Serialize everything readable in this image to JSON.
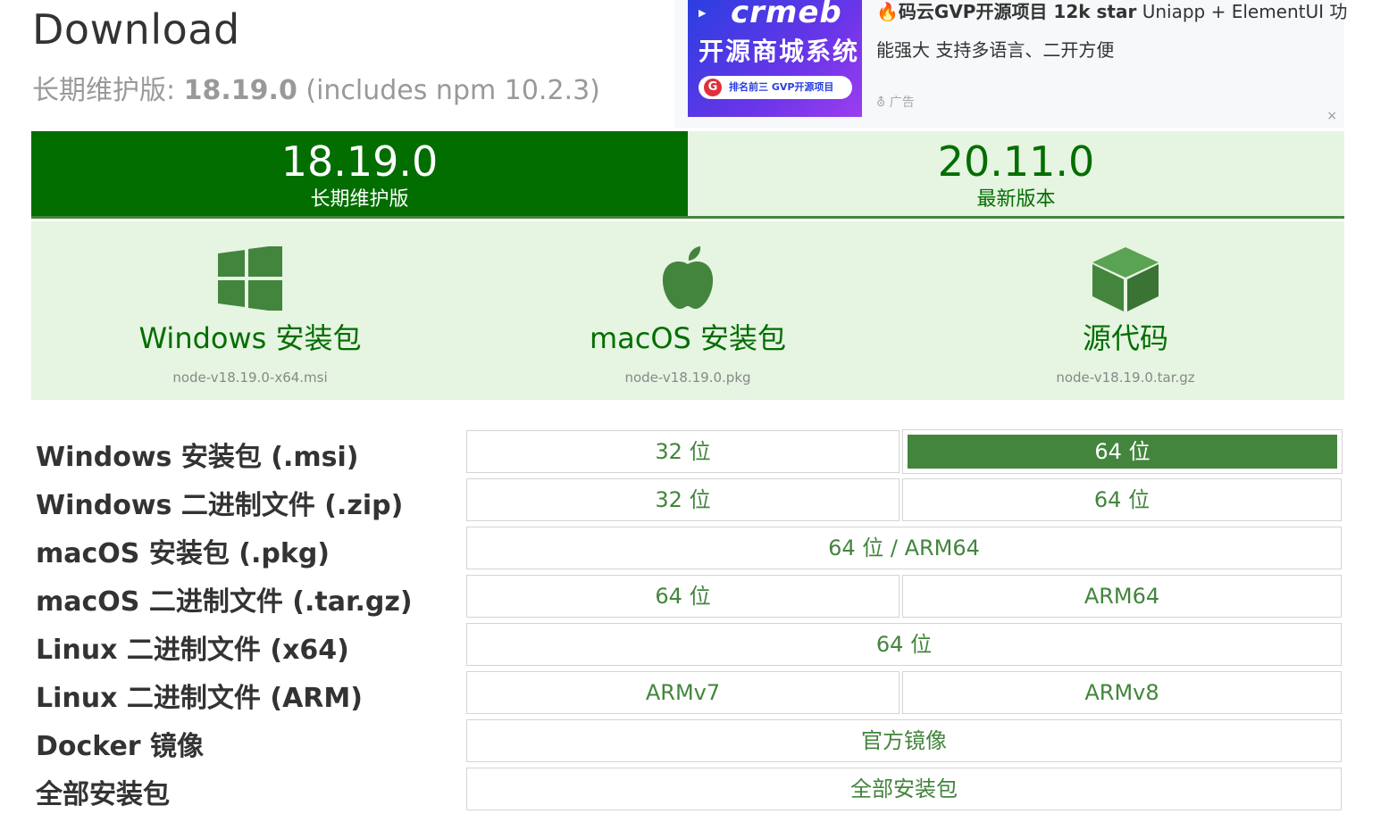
{
  "header": {
    "title": "Download",
    "lts_prefix": "长期维护版: ",
    "lts_version": "18.19.0",
    "lts_suffix": " (includes npm 10.2.3)"
  },
  "ad": {
    "image_logo": "crmeb",
    "image_headline": "开源商城系统",
    "image_badge": "排名前三 GVP开源项目",
    "title_bold": "码云GVP开源项目 12k star",
    "title_rest": " Uniapp + ElementUI 功",
    "title_line2": "能强大 支持多语言、二开方便",
    "label": "广告",
    "close": "×"
  },
  "tabs": [
    {
      "version": "18.19.0",
      "label": "长期维护版"
    },
    {
      "version": "20.11.0",
      "label": "最新版本"
    }
  ],
  "installers": [
    {
      "name": "Windows 安装包",
      "file": "node-v18.19.0-x64.msi",
      "icon": "windows-icon"
    },
    {
      "name": "macOS 安装包",
      "file": "node-v18.19.0.pkg",
      "icon": "apple-icon"
    },
    {
      "name": "源代码",
      "file": "node-v18.19.0.tar.gz",
      "icon": "box-icon"
    }
  ],
  "downloads": {
    "rows": [
      {
        "label": "Windows 安装包 (.msi)",
        "cells": [
          "32 位",
          "64 位"
        ]
      },
      {
        "label": "Windows 二进制文件 (.zip)",
        "cells": [
          "32 位",
          "64 位"
        ]
      },
      {
        "label": "macOS 安装包 (.pkg)",
        "cells": [
          "64 位 / ARM64"
        ]
      },
      {
        "label": "macOS 二进制文件 (.tar.gz)",
        "cells": [
          "64 位",
          "ARM64"
        ]
      },
      {
        "label": "Linux 二进制文件 (x64)",
        "cells": [
          "64 位"
        ]
      },
      {
        "label": "Linux 二进制文件 (ARM)",
        "cells": [
          "ARMv7",
          "ARMv8"
        ]
      },
      {
        "label": "Docker 镜像",
        "cells": [
          "官方镜像"
        ]
      },
      {
        "label": "全部安装包",
        "cells": [
          "全部安装包"
        ]
      }
    ],
    "selected": "64 位"
  },
  "colors": {
    "brand_dark": "#026e00",
    "brand": "#43853d",
    "brand_light": "#e6f4e2"
  }
}
